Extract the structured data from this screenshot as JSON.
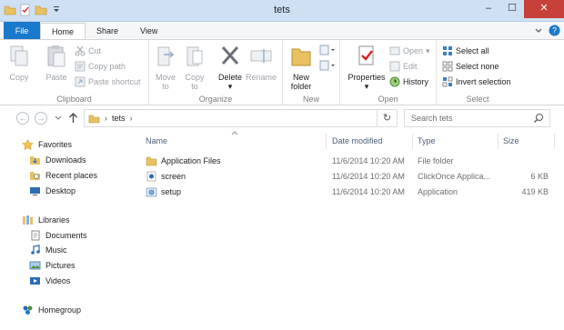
{
  "window": {
    "title": "tets",
    "controls": {
      "minimize": "–",
      "maximize": "☐",
      "close": "✕"
    }
  },
  "tabs": [
    {
      "label": "File"
    },
    {
      "label": "Home"
    },
    {
      "label": "Share"
    },
    {
      "label": "View"
    }
  ],
  "ribbon": {
    "clipboard": {
      "label": "Clipboard",
      "copy": "Copy",
      "paste": "Paste",
      "cut": "Cut",
      "copy_path": "Copy path",
      "paste_shortcut": "Paste shortcut"
    },
    "organize": {
      "label": "Organize",
      "move_to": "Move",
      "move_to2": "to",
      "copy_to": "Copy",
      "copy_to2": "to",
      "delete": "Delete",
      "rename": "Rename"
    },
    "new": {
      "label": "New",
      "new_folder": "New",
      "new_folder2": "folder"
    },
    "open": {
      "label": "Open",
      "properties": "Properties",
      "open": "Open",
      "edit": "Edit",
      "history": "History"
    },
    "select": {
      "label": "Select",
      "select_all": "Select all",
      "select_none": "Select none",
      "invert_selection": "Invert selection"
    }
  },
  "address": {
    "path_item": "tets",
    "search_placeholder": "Search tets"
  },
  "nav": {
    "favorites": "Favorites",
    "downloads": "Downloads",
    "recent_places": "Recent places",
    "desktop": "Desktop",
    "libraries": "Libraries",
    "documents": "Documents",
    "music": "Music",
    "pictures": "Pictures",
    "videos": "Videos",
    "homegroup": "Homegroup"
  },
  "columns": {
    "name": "Name",
    "date_modified": "Date modified",
    "type": "Type",
    "size": "Size"
  },
  "files": [
    {
      "name": "Application Files",
      "date": "11/6/2014 10:20 AM",
      "type": "File folder",
      "size": "",
      "icon": "folder-icon"
    },
    {
      "name": "screen",
      "date": "11/6/2014 10:20 AM",
      "type": "ClickOnce Applica...",
      "size": "6 KB",
      "icon": "clickonce-icon"
    },
    {
      "name": "setup",
      "date": "11/6/2014 10:20 AM",
      "type": "Application",
      "size": "419 KB",
      "icon": "setup-icon"
    }
  ],
  "colors": {
    "accent": "#1979ca",
    "titlebar": "#cfe0f4",
    "close": "#c7413a",
    "folder": "#e8c163"
  }
}
